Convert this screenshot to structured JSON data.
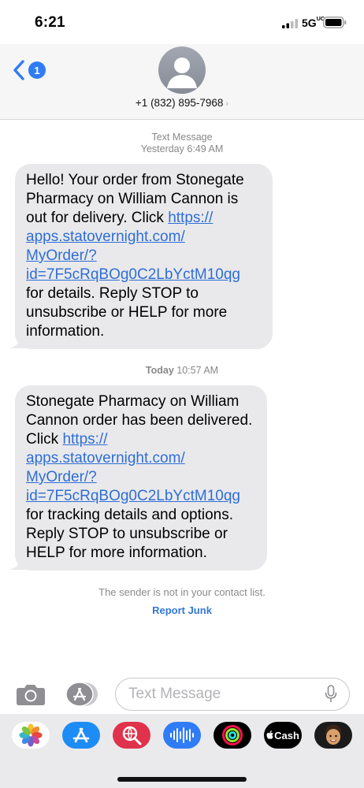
{
  "status_bar": {
    "time": "6:21",
    "network": "5G",
    "network_suffix": "UC"
  },
  "header": {
    "back_badge_count": "1",
    "contact_number": "+1 (832) 895-7968",
    "contact_chevron": "›"
  },
  "messages": [
    {
      "timestamp_label": "Text Message",
      "timestamp_day": "Yesterday",
      "timestamp_time": "6:49 AM",
      "text_before": "Hello! Your order from Stonegate Pharmacy on William Cannon is out for delivery. Click ",
      "link_lines": [
        "https://",
        "apps.statovernight.com/",
        "MyOrder/?",
        "id=7F5cRqBOg0C2LbYctM10qg"
      ],
      "text_after": "for details.   Reply STOP to unsubscribe or HELP for more information."
    },
    {
      "timestamp_day": "Today",
      "timestamp_time": "10:57 AM",
      "text_before": "Stonegate Pharmacy on William Cannon order has been delivered. Click ",
      "link_lines": [
        "https://",
        "apps.statovernight.com/",
        "MyOrder/?",
        "id=7F5cRqBOg0C2LbYctM10qg"
      ],
      "text_after": "for tracking details and options. Reply STOP to unsubscribe or HELP for more information."
    }
  ],
  "sender_note": "The sender is not in your contact list.",
  "report_junk_label": "Report Junk",
  "compose": {
    "placeholder": "Text Message"
  },
  "app_drawer": {
    "apps": [
      "photos-icon",
      "app-store-icon",
      "search-images-icon",
      "audio-message-icon",
      "activity-icon",
      "apple-cash-icon",
      "memoji-icon"
    ],
    "cash_label": "Cash"
  },
  "colors": {
    "link": "#2f6ed6",
    "badge": "#2f7cf6",
    "bubble": "#e9e9eb",
    "report_junk": "#3478d6"
  }
}
